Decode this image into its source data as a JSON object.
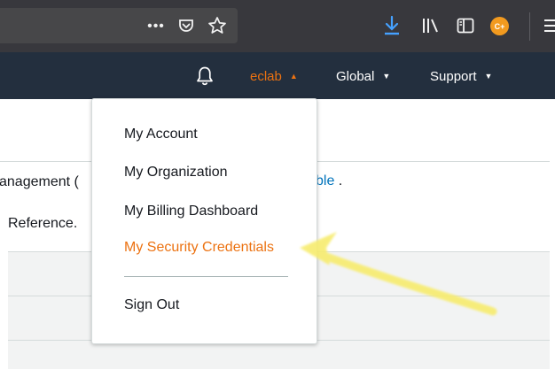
{
  "browser": {
    "toolbar_icons": [
      "more-icon",
      "pocket-icon",
      "star-icon",
      "download-icon",
      "library-icon",
      "sidebar-icon",
      "extension-icon",
      "hamburger-icon"
    ],
    "more_glyph": "•••",
    "extension_badge": "C+"
  },
  "nav": {
    "account_label": "eclab",
    "region_label": "Global",
    "support_label": "Support",
    "caret_up": "▲",
    "caret_down": "▼"
  },
  "page": {
    "fragment_left": "anagement (",
    "fragment_link": "ble",
    "fragment_after_link": " .",
    "fragment_reference": "Reference."
  },
  "menu": {
    "items": [
      {
        "label": "My Account"
      },
      {
        "label": "My Organization"
      },
      {
        "label": "My Billing Dashboard"
      },
      {
        "label": "My Security Credentials"
      }
    ],
    "sign_out": "Sign Out"
  },
  "colors": {
    "browser_bar": "#38383d",
    "nav_bar": "#232f3e",
    "accent_orange": "#ec7211",
    "link_blue": "#0073bb",
    "highlight_arrow": "#f7ec6e"
  }
}
